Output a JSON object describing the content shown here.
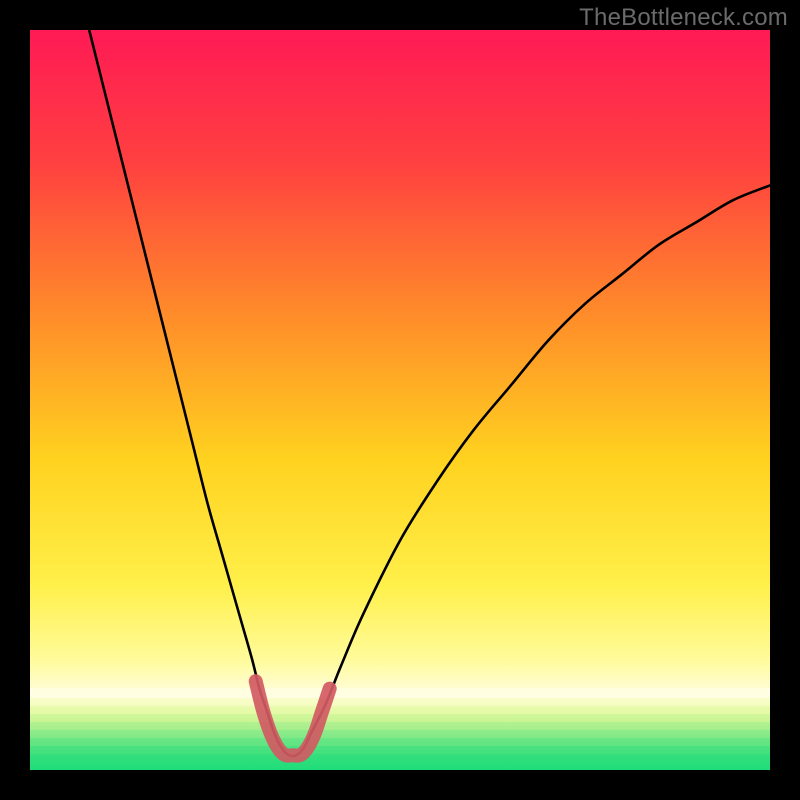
{
  "watermark": "TheBottleneck.com",
  "colors": {
    "frame": "#000000",
    "gradient_top": "#ff1a55",
    "gradient_mid1": "#ff6a2a",
    "gradient_mid2": "#ffd21f",
    "gradient_mid3": "#fff670",
    "gradient_bottom_band": "#fff9c8",
    "gradient_green1": "#9cf08a",
    "gradient_green2": "#28e57b",
    "curve_stroke": "#000000",
    "highlight_stroke": "#d15a63"
  },
  "chart_data": {
    "type": "line",
    "title": "",
    "xlabel": "",
    "ylabel": "",
    "xlim": [
      0,
      100
    ],
    "ylim": [
      0,
      100
    ],
    "series": [
      {
        "name": "bottleneck-curve",
        "x": [
          8,
          10,
          12,
          14,
          16,
          18,
          20,
          22,
          24,
          26,
          28,
          30,
          31,
          32,
          33,
          34,
          35,
          36,
          37,
          38,
          40,
          42,
          45,
          50,
          55,
          60,
          65,
          70,
          75,
          80,
          85,
          90,
          95,
          100
        ],
        "y": [
          100,
          92,
          84,
          76,
          68,
          60,
          52,
          44,
          36,
          29,
          22,
          15,
          11,
          8,
          5,
          3,
          2,
          2,
          3,
          5,
          9,
          14,
          21,
          31,
          39,
          46,
          52,
          58,
          63,
          67,
          71,
          74,
          77,
          79
        ]
      },
      {
        "name": "optimal-highlight",
        "x": [
          30.5,
          31.5,
          32.5,
          33.5,
          34.5,
          35.5,
          36.5,
          37.5,
          38.5,
          39.5,
          40.5
        ],
        "y": [
          12,
          8,
          5,
          3,
          2,
          2,
          2,
          3,
          5,
          8,
          11
        ]
      }
    ],
    "annotations": []
  }
}
